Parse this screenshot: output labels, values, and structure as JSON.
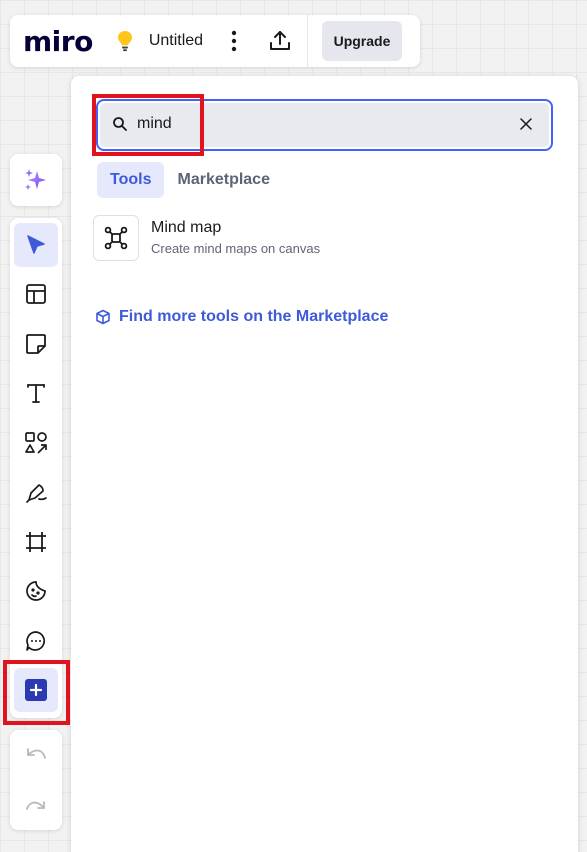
{
  "header": {
    "logo": "miro",
    "board_title": "Untitled",
    "upgrade_label": "Upgrade"
  },
  "search": {
    "value": "mind",
    "placeholder": ""
  },
  "tabs": [
    {
      "label": "Tools",
      "active": true
    },
    {
      "label": "Marketplace",
      "active": false
    }
  ],
  "results": [
    {
      "title": "Mind map",
      "description": "Create mind maps on canvas",
      "icon": "mind-map-icon"
    }
  ],
  "find_more_label": "Find more tools on the Marketplace",
  "toolbar": {
    "tools": [
      "select-icon",
      "templates-icon",
      "sticky-note-icon",
      "text-icon",
      "shapes-icon",
      "pen-icon",
      "frame-icon",
      "emoji-icon",
      "comment-icon",
      "more-apps-icon"
    ],
    "active": "select-icon"
  },
  "colors": {
    "accent": "#4262ff",
    "active_tab_bg": "#e6e9fb",
    "highlight": "#e0141e",
    "ai_gradient": "#8b5cf6"
  }
}
